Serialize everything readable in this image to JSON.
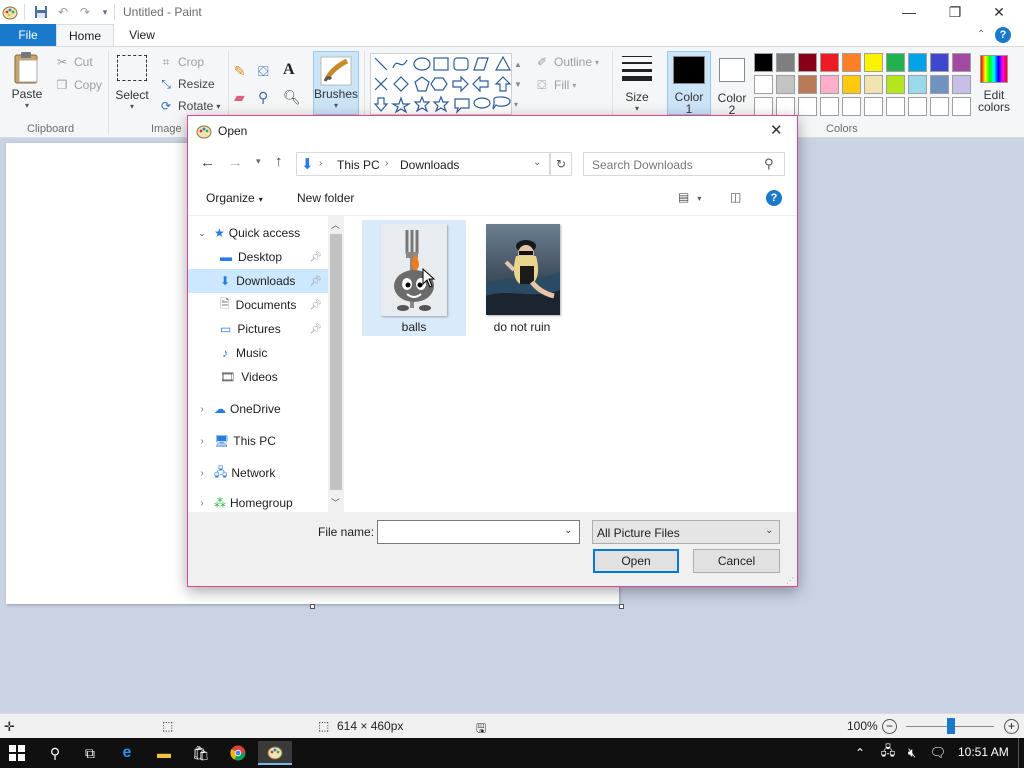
{
  "window": {
    "title": "Untitled - Paint",
    "minimize": "—",
    "maximize": "❐",
    "close": "✕"
  },
  "tabs": {
    "file": "File",
    "home": "Home",
    "view": "View"
  },
  "ribbon": {
    "clipboard": {
      "paste": "Paste",
      "cut": "Cut",
      "copy": "Copy",
      "group": "Clipboard"
    },
    "image": {
      "select": "Select",
      "crop": "Crop",
      "resize": "Resize",
      "rotate": "Rotate",
      "group": "Image"
    },
    "brushes": "Brushes",
    "shapes": {
      "outline": "Outline",
      "fill": "Fill"
    },
    "size": "Size",
    "color1": {
      "line1": "Color",
      "line2": "1"
    },
    "color2": {
      "line1": "Color",
      "line2": "2"
    },
    "colors_group": "Colors",
    "edit_colors": {
      "line1": "Edit",
      "line2": "colors"
    },
    "palette_row1": [
      "#000000",
      "#7f7f7f",
      "#880015",
      "#ed1c24",
      "#ff7f27",
      "#fff200",
      "#22b14c",
      "#00a2e8",
      "#3f48cc",
      "#a349a4"
    ],
    "palette_row2": [
      "#ffffff",
      "#c3c3c3",
      "#b97a57",
      "#ffaec9",
      "#ffc90e",
      "#efe4b0",
      "#b5e61d",
      "#99d9ea",
      "#7092be",
      "#c8bfe7"
    ]
  },
  "status": {
    "selection_size": "",
    "canvas_size": "614 × 460px",
    "zoom": "100%"
  },
  "taskbar": {
    "time": "10:51 AM"
  },
  "dialog": {
    "title": "Open",
    "close": "✕",
    "breadcrumb": [
      "This PC",
      "Downloads"
    ],
    "search_placeholder": "Search Downloads",
    "organize": "Organize",
    "new_folder": "New folder",
    "nav": {
      "quick_access": "Quick access",
      "desktop": "Desktop",
      "downloads": "Downloads",
      "documents": "Documents",
      "pictures": "Pictures",
      "music": "Music",
      "videos": "Videos",
      "onedrive": "OneDrive",
      "this_pc": "This PC",
      "network": "Network",
      "homegroup": "Homegroup"
    },
    "files": [
      {
        "name": "balls"
      },
      {
        "name": "do not ruin"
      }
    ],
    "file_name_label": "File name:",
    "file_name_value": "",
    "file_type": "All Picture Files",
    "open_button": "Open",
    "cancel_button": "Cancel"
  }
}
